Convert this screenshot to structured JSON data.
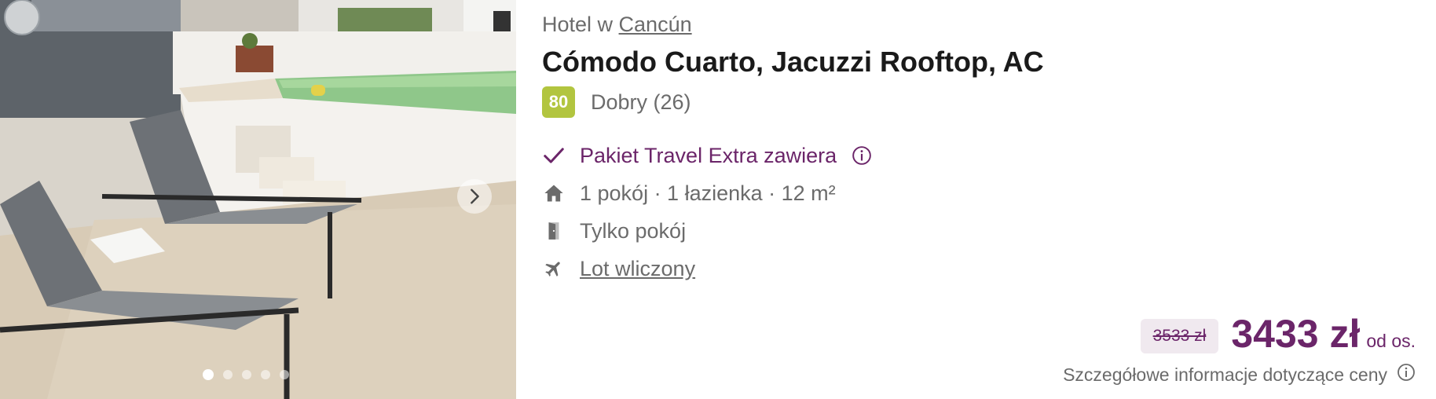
{
  "listing": {
    "kicker_prefix": "Hotel w",
    "location": "Cancún",
    "title": "Cómodo Cuarto, Jacuzzi Rooftop, AC",
    "rating": {
      "score": "80",
      "label": "Dobry (26)",
      "color": "#b2c53f"
    },
    "features": {
      "package": "Pakiet Travel Extra zawiera",
      "rooms": "1 pokój · 1 łazienka · 12 m²",
      "board": "Tylko pokój",
      "flight": "Lot wliczony"
    },
    "price": {
      "old": "3533 zł",
      "current": "3433 zł",
      "per_person": "od os.",
      "details": "Szczegółowe informacje dotyczące ceny"
    },
    "gallery": {
      "slides": 5,
      "active_index": 0
    },
    "icons": {
      "package": "check-icon",
      "package_info": "info-icon",
      "rooms": "house-icon",
      "board": "door-icon",
      "flight": "plane-icon",
      "next": "chevron-right-icon"
    },
    "colors": {
      "accent": "#6b2569",
      "muted": "#6b6b6b",
      "price_bg": "#f0e9ef"
    }
  }
}
